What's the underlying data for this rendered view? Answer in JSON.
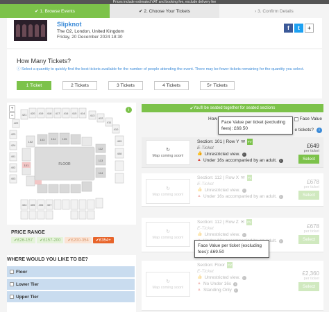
{
  "top_note": "Prices include estimated VAT and booking fee, exclude delivery fee",
  "steps": [
    {
      "label": "1. Browse Events",
      "icon": "check-icon"
    },
    {
      "label": "2. Choose Your Tickets",
      "icon": "check-icon"
    },
    {
      "label": "3. Confirm Details",
      "icon": "chevron-icon"
    }
  ],
  "event": {
    "title": "Slipknot",
    "venue": "The O2, London, United Kingdom",
    "date": "Friday, 20 December 2024 18:30"
  },
  "social": [
    "f",
    "t",
    "+"
  ],
  "how_many": {
    "title": "How Many Tickets?",
    "note": "Select a quantity to quickly find the best tickets available for the number of people attending the event. There may be fewer tickets remaining for the quantity you select.",
    "options": [
      "1 Ticket",
      "2 Tickets",
      "3 Tickets",
      "4 Tickets",
      "5+ Tickets"
    ],
    "selected_index": 0
  },
  "map": {
    "zoom_in": "+",
    "zoom_out": "−",
    "floor_label": "FLOOR",
    "section_labels": [
      "421",
      "420",
      "419",
      "418",
      "417",
      "416",
      "415",
      "414",
      "422",
      "413",
      "423",
      "412",
      "424",
      "411",
      "401",
      "410",
      "402",
      "409",
      "403",
      "408",
      "404",
      "405",
      "406",
      "407",
      "101",
      "112",
      "113",
      "114",
      "102",
      "103",
      "104",
      "105"
    ]
  },
  "price_range": {
    "title": "PRICE RANGE",
    "chips": [
      "£26-157",
      "£157-200",
      "£200-354",
      "£354+"
    ]
  },
  "where": {
    "title": "WHERE WOULD YOU LIKE TO BE?",
    "zones": [
      "Floor",
      "Lower Tier",
      "Upper Tier"
    ]
  },
  "list": {
    "seated_note": "You'll be seated together for seated sections",
    "sort_how": "How",
    "sort_face_value": "Face Value",
    "sort_tickets": "e tickets?",
    "map_soon": "Map coming soon!",
    "listings": [
      {
        "section": "Section: 101 | Row Y",
        "type": "E-Ticket",
        "features": [
          {
            "kind": "ok",
            "text": "Unrestricted view."
          },
          {
            "kind": "warn",
            "text": "Under 16s accompanied by an adult."
          }
        ],
        "price": "£649",
        "per": "per ticket",
        "button": "Select",
        "faded": false
      },
      {
        "section": "Section: 112 | Row X",
        "type": "E-Ticket",
        "features": [
          {
            "kind": "ok",
            "text": "Unrestricted view."
          },
          {
            "kind": "warn",
            "text": "Under 16s accompanied by an adult."
          }
        ],
        "price": "£678",
        "per": "per ticket",
        "button": "Select",
        "faded": true
      },
      {
        "section": "Section: 112 | Row Z",
        "type": "E-Ticket",
        "features": [
          {
            "kind": "ok",
            "text": "Unrestricted view."
          },
          {
            "kind": "warn",
            "text": "Under 16s accompanied by an adult."
          }
        ],
        "price": "£678",
        "per": "per ticket",
        "button": "Select",
        "faded": true
      },
      {
        "section": "Section: Floor",
        "type": "E-Ticket",
        "features": [
          {
            "kind": "ok",
            "text": "Unrestricted view."
          },
          {
            "kind": "warn",
            "text": "No Under 16s"
          },
          {
            "kind": "warn",
            "text": "Standing Only"
          }
        ],
        "price": "£2,360",
        "per": "per ticket",
        "button": "Select",
        "faded": true
      }
    ]
  },
  "tooltips": [
    {
      "text": "Face Value per ticket (excluding fees): £69.50"
    },
    {
      "text": "Face Value per ticket (excluding fees): £69.50"
    }
  ],
  "colors": {
    "accent_green": "#7cc24a",
    "link_blue": "#3a8ad8",
    "warn_red": "#d9453a",
    "price_orange": "#e8642a"
  }
}
